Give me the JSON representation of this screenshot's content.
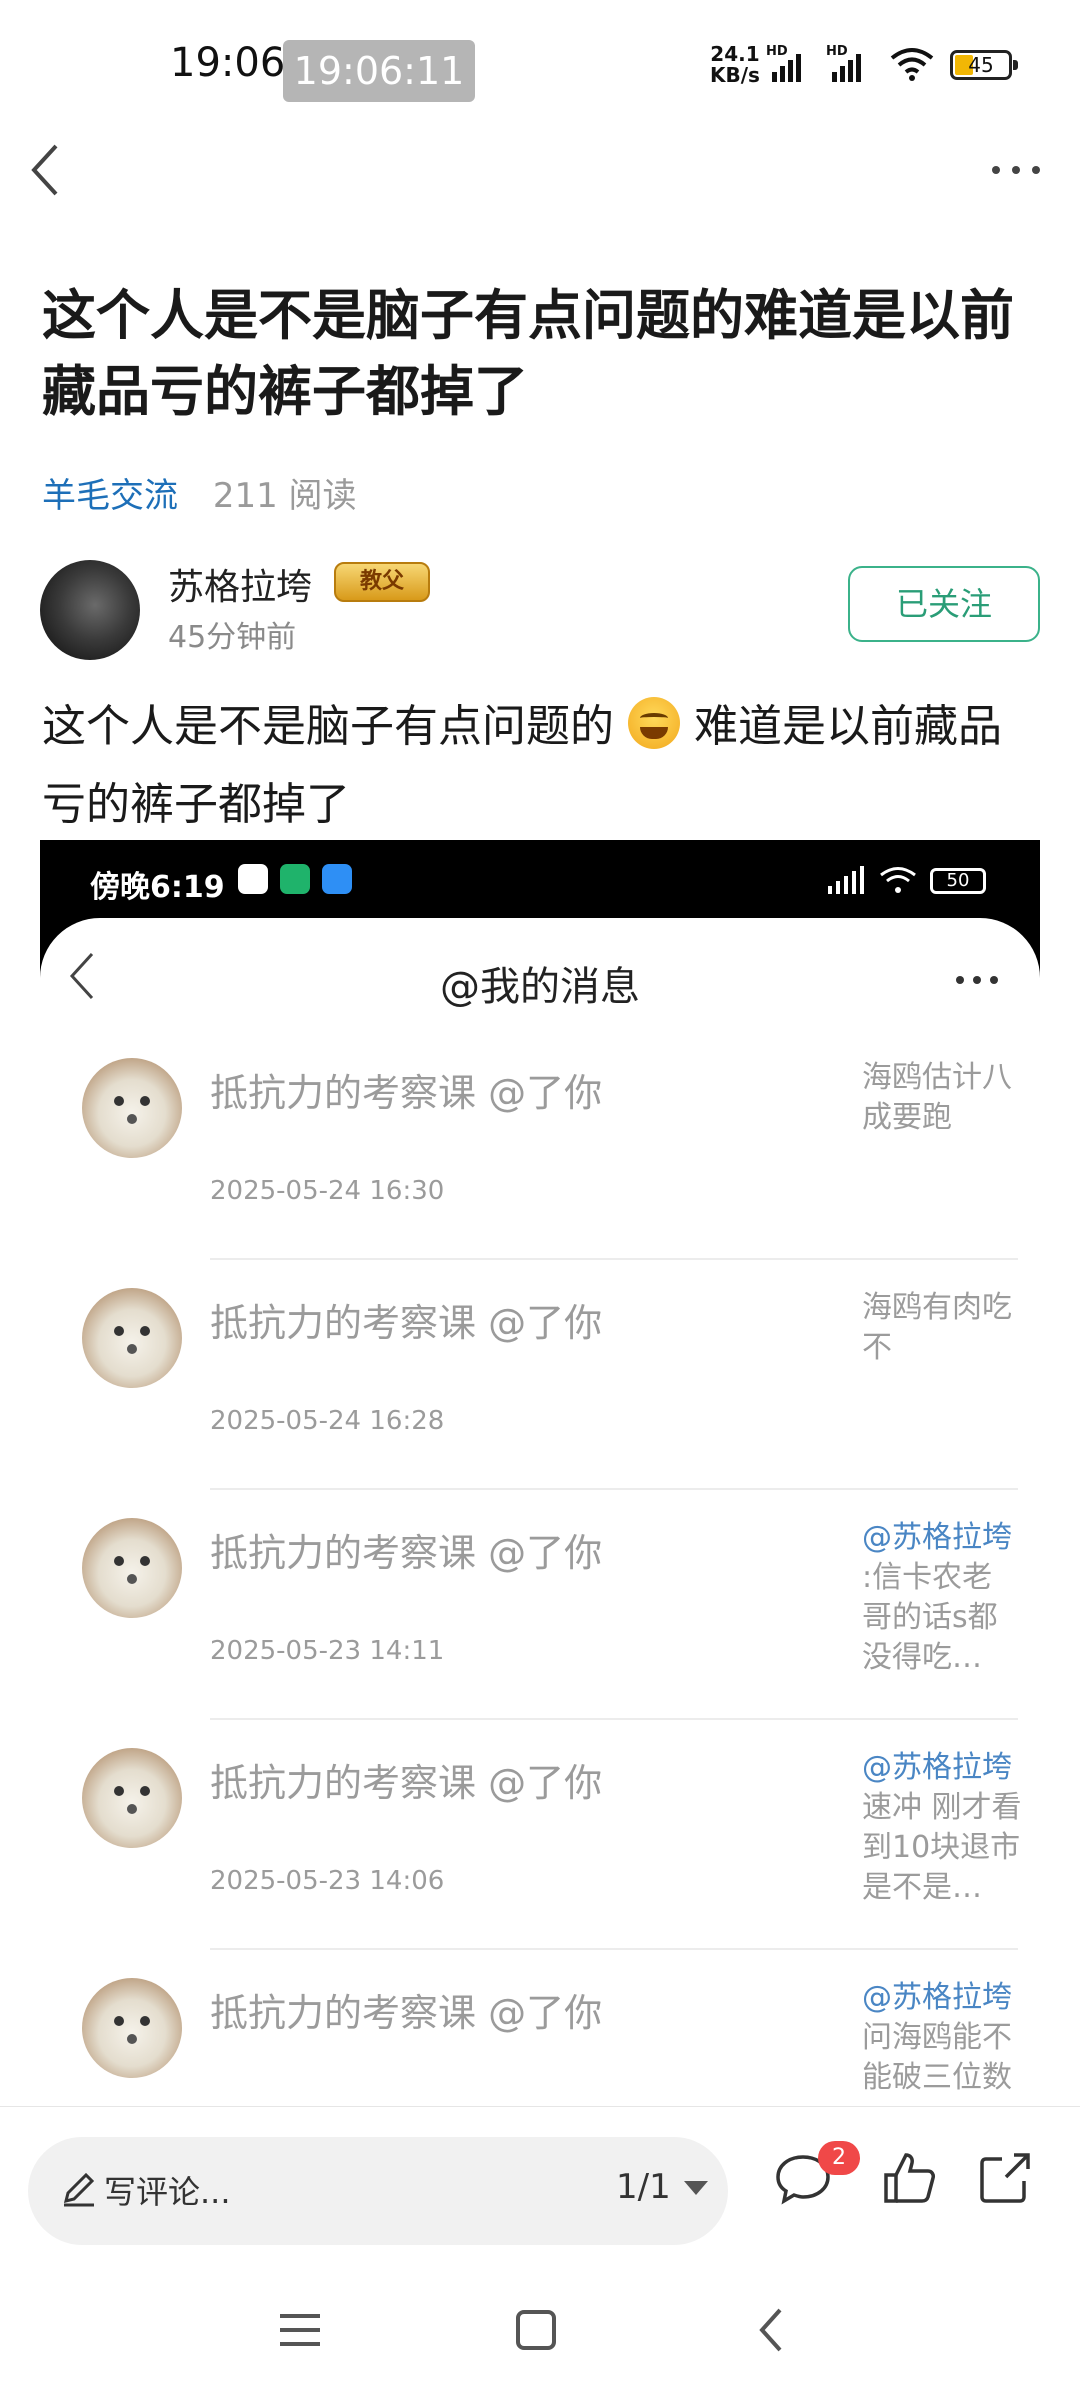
{
  "status_bar": {
    "time": "19:06",
    "clock_chip": "19:06:11",
    "net_speed_value": "24.1",
    "net_speed_unit": "KB/s",
    "signal_label": "HD",
    "battery": "45"
  },
  "post": {
    "title": "这个人是不是脑子有点问题的难道是以前藏品亏的裤子都掉了",
    "channel": "羊毛交流",
    "reads": "211 阅读",
    "author": {
      "name": "苏格拉垮",
      "badge": "教父",
      "time": "45分钟前"
    },
    "follow_label": "已关注",
    "body_before_emoji": "这个人是不是脑子有点问题的",
    "body_after_emoji": "难道是以前藏品亏的裤子都掉了"
  },
  "screenshot": {
    "status_time": "傍晚6:19",
    "battery": "50",
    "title": "@我的消息",
    "messages": [
      {
        "title": "抵抗力的考察课 @了你",
        "date": "2025-05-24 16:30",
        "mention": "",
        "ref": "海鸥估计八成要跑"
      },
      {
        "title": "抵抗力的考察课 @了你",
        "date": "2025-05-24 16:28",
        "mention": "",
        "ref": "海鸥有肉吃不"
      },
      {
        "title": "抵抗力的考察课 @了你",
        "date": "2025-05-23 14:11",
        "mention": "@苏格拉垮",
        "ref": " :信卡农老哥的话s都没得吃…"
      },
      {
        "title": "抵抗力的考察课 @了你",
        "date": "2025-05-23 14:06",
        "mention": "@苏格拉垮",
        "ref": "速冲 刚才看到10块退市是不是…"
      },
      {
        "title": "抵抗力的考察课 @了你",
        "date": "",
        "mention": "@苏格拉垮",
        "ref": "问海鸥能不能破三位数"
      }
    ]
  },
  "bottom_bar": {
    "comment_placeholder": "写评论...",
    "pager": "1/1",
    "comment_count": "2"
  },
  "colors": {
    "accent_green": "#2a9d77",
    "link_blue": "#1d6fb8",
    "badge_red": "#f04848"
  },
  "icons": [
    "back-icon",
    "more-icon",
    "pen-icon",
    "dropdown-caret-icon",
    "comment-icon",
    "like-icon",
    "share-icon",
    "menu-icon",
    "home-icon"
  ]
}
